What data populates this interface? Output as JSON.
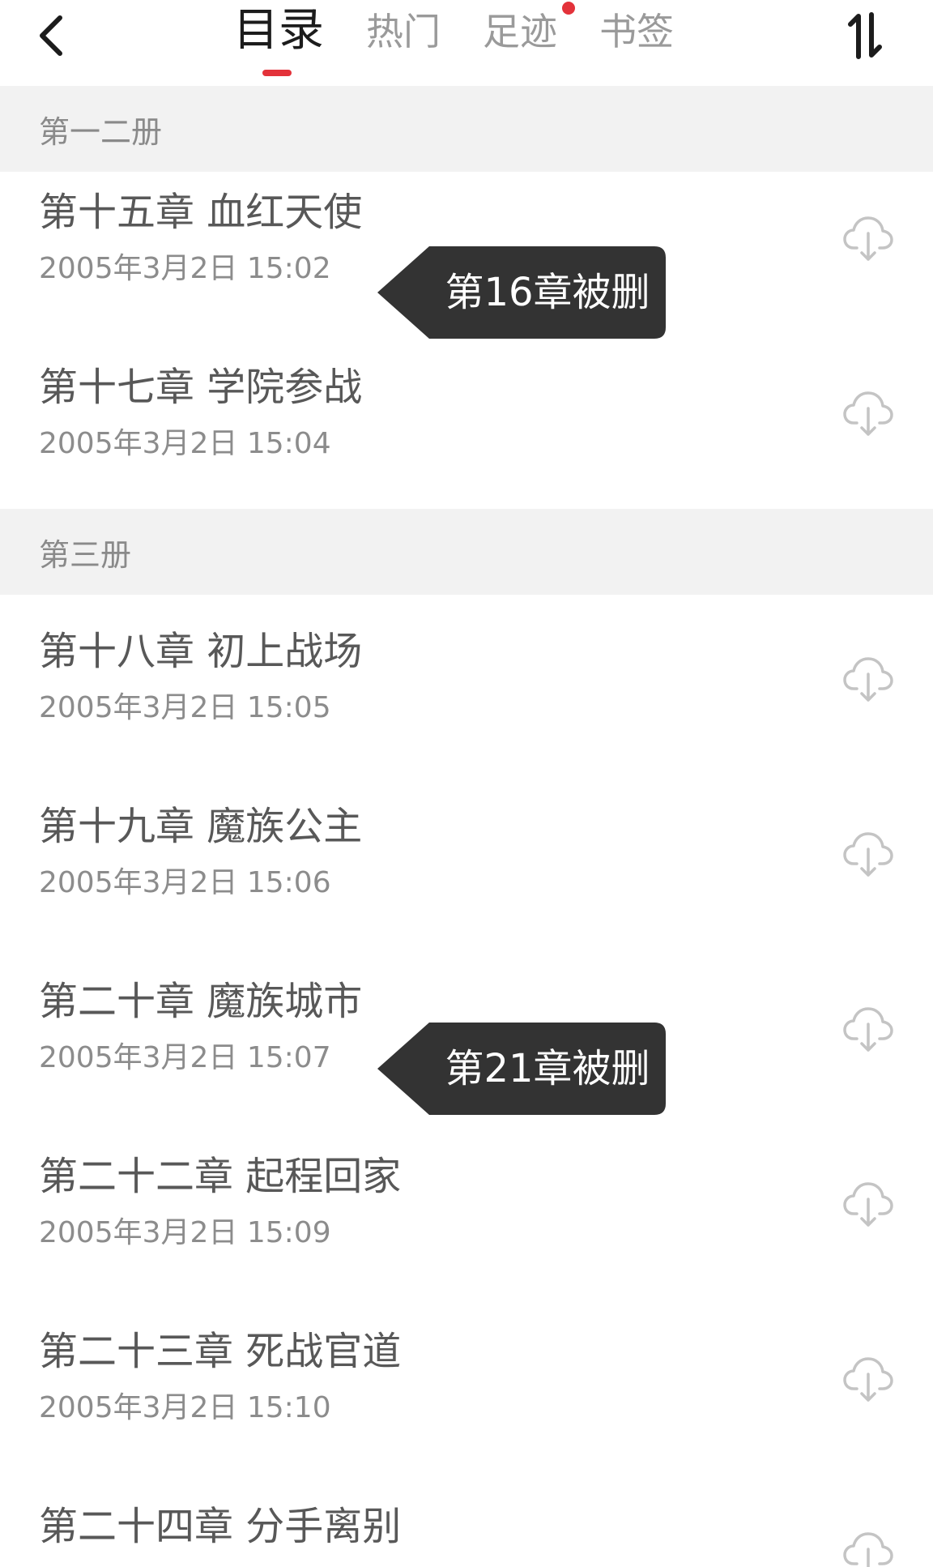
{
  "header": {
    "back_icon": "chevron-left-icon",
    "tabs": [
      {
        "label": "目录",
        "active": true
      },
      {
        "label": "热门",
        "active": false
      },
      {
        "label": "足迹",
        "active": false,
        "badge": true
      },
      {
        "label": "书签",
        "active": false
      }
    ],
    "sort_icon": "sort-toggle-icon",
    "accent_color": "#e3323a"
  },
  "volumes": [
    {
      "title": "第一二册",
      "chapters": [
        {
          "title": "第十五章 血红天使",
          "time": "2005年3月2日 15:02"
        },
        {
          "title": "第十七章 学院参战",
          "time": "2005年3月2日 15:04"
        }
      ]
    },
    {
      "title": "第三册",
      "chapters": [
        {
          "title": "第十八章 初上战场",
          "time": "2005年3月2日 15:05"
        },
        {
          "title": "第十九章 魔族公主",
          "time": "2005年3月2日 15:06"
        },
        {
          "title": "第二十章 魔族城市",
          "time": "2005年3月2日 15:07"
        },
        {
          "title": "第二十二章 起程回家",
          "time": "2005年3月2日 15:09"
        },
        {
          "title": "第二十三章 死战官道",
          "time": "2005年3月2日 15:10"
        },
        {
          "title": "第二十四章 分手离别",
          "time": ""
        }
      ]
    }
  ],
  "chapter_download_icon": "cloud-download-icon",
  "callouts": [
    {
      "label": "第16章被删"
    },
    {
      "label": "第21章被删"
    }
  ]
}
